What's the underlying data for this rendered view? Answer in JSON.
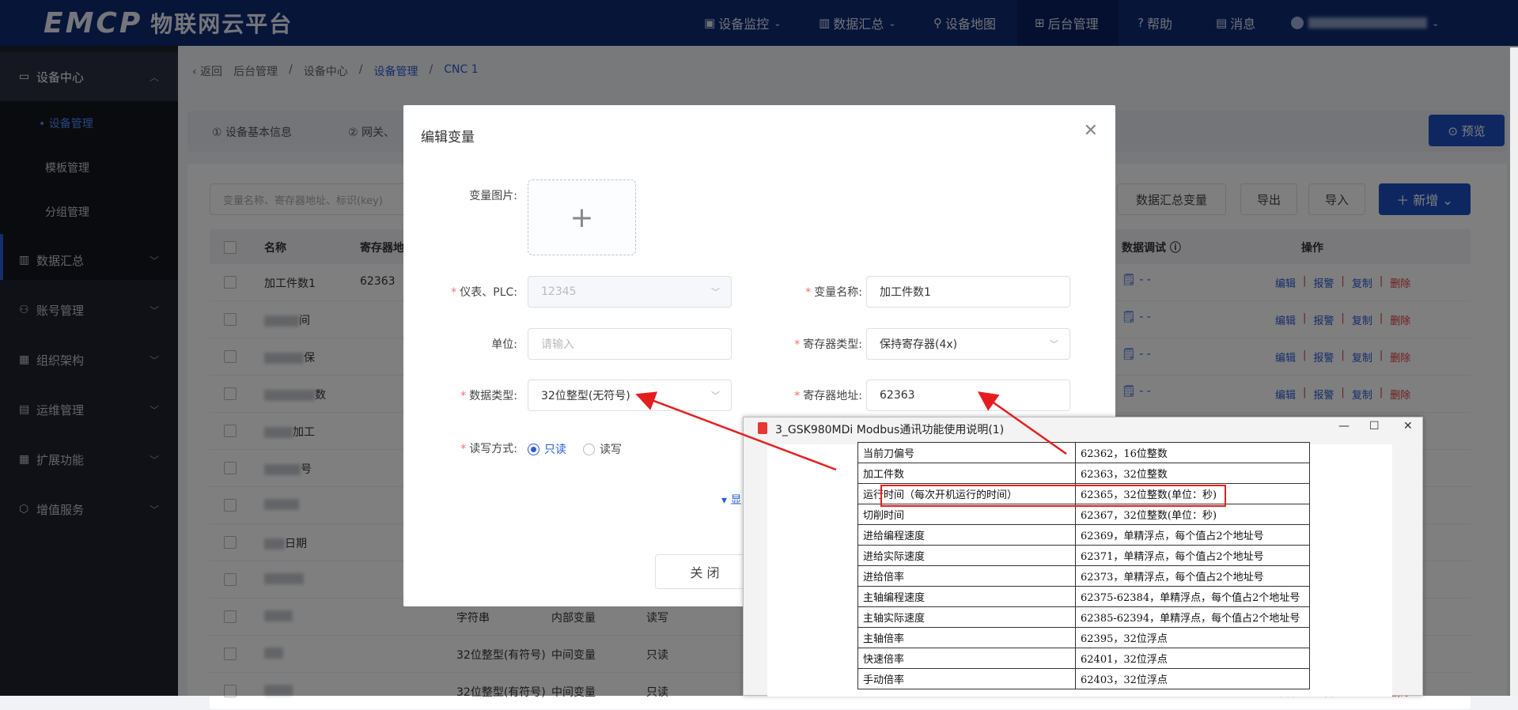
{
  "header": {
    "logo_en": "EMCP",
    "logo_cn": "物联网云平台",
    "nav": [
      {
        "icon": "▣",
        "label": "设备监控",
        "arrow": "⌄"
      },
      {
        "icon": "▥",
        "label": "数据汇总",
        "arrow": "⌄"
      },
      {
        "icon": "⚲",
        "label": "设备地图",
        "arrow": ""
      },
      {
        "icon": "⊞",
        "label": "后台管理",
        "arrow": ""
      },
      {
        "icon": "?",
        "label": "帮助",
        "arrow": ""
      },
      {
        "icon": "▤",
        "label": "消息",
        "arrow": ""
      }
    ],
    "user_arrow": "⌄"
  },
  "sidebar": {
    "groups": [
      {
        "icon": "▭",
        "label": "设备中心",
        "chevron": "︿"
      },
      {
        "icon": "▥",
        "label": "数据汇总",
        "chevron": "﹀"
      },
      {
        "icon": "⚇",
        "label": "账号管理",
        "chevron": "﹀"
      },
      {
        "icon": "▦",
        "label": "组织架构",
        "chevron": "﹀"
      },
      {
        "icon": "▤",
        "label": "运维管理",
        "chevron": "﹀"
      },
      {
        "icon": "▦",
        "label": "扩展功能",
        "chevron": "﹀"
      },
      {
        "icon": "⬡",
        "label": "增值服务",
        "chevron": "﹀"
      }
    ],
    "subitems": [
      "• 设备管理",
      "模板管理",
      "分组管理"
    ]
  },
  "breadcrumb": {
    "back": "‹ 返回",
    "items": [
      "后台管理",
      "/",
      "设备中心",
      "/",
      "设备管理",
      "/",
      "CNC 1"
    ]
  },
  "tabs": [
    "① 设备基本信息",
    "② 网关、"
  ],
  "preview_label": "⊙ 预览",
  "toolbar": {
    "search_placeholder": "变量名称、寄存器地址、标识(key)",
    "summary_btn": "数据汇总变量",
    "export_btn": "导出",
    "import_btn": "导入",
    "add_btn": "＋ 新增 ⌄"
  },
  "table": {
    "headers": [
      "名称",
      "寄存器地",
      "数据调试 ⓘ",
      "操作"
    ],
    "rows": [
      {
        "name": "加工件数1",
        "addr": "62363",
        "type": "",
        "kind": "",
        "rw": ""
      },
      {
        "name": "间",
        "addr": "",
        "type": "",
        "kind": "",
        "rw": ""
      },
      {
        "name": "保",
        "addr": "",
        "type": "",
        "kind": "",
        "rw": ""
      },
      {
        "name": "数",
        "addr": "",
        "type": "",
        "kind": "",
        "rw": ""
      },
      {
        "name": "加工",
        "addr": "",
        "type": "",
        "kind": "",
        "rw": ""
      },
      {
        "name": "号",
        "addr": "",
        "type": "",
        "kind": "",
        "rw": ""
      },
      {
        "name": "",
        "addr": "",
        "type": "",
        "kind": "",
        "rw": ""
      },
      {
        "name": "日期",
        "addr": "",
        "type": "",
        "kind": "",
        "rw": ""
      },
      {
        "name": "",
        "addr": "",
        "type": "",
        "kind": "",
        "rw": ""
      },
      {
        "name": "",
        "addr": "",
        "type": "字符串",
        "kind": "内部变量",
        "rw": "读写"
      },
      {
        "name": "",
        "addr": "",
        "type": "32位整型(有符号)",
        "kind": "中间变量",
        "rw": "只读"
      },
      {
        "name": "",
        "addr": "",
        "type": "32位整型(有符号)",
        "kind": "中间变量",
        "rw": "只读"
      }
    ],
    "debug_value": "- -",
    "ops": {
      "edit": "编辑",
      "alarm": "报警",
      "copy": "复制",
      "delete": "删除",
      "sep": "|"
    }
  },
  "modal": {
    "title": "编辑变量",
    "close": "✕",
    "image_label": "变量图片:",
    "upload_plus": "+",
    "plc_label": "仪表、PLC:",
    "plc_value": "12345",
    "varname_label": "变量名称:",
    "varname_value": "加工件数1",
    "unit_label": "单位:",
    "unit_placeholder": "请输入",
    "regtype_label": "寄存器类型:",
    "regtype_value": "保持寄存器(4x)",
    "datatype_label": "数据类型:",
    "datatype_value": "32位整型(无符号)",
    "regaddr_label": "寄存器地址:",
    "regaddr_value": "62363",
    "rw_label": "读写方式:",
    "rw_options": [
      "只读",
      "读写"
    ],
    "more_label": "▾ 显",
    "close_btn": "关 闭"
  },
  "pdf": {
    "title": "3_GSK980MDi Modbus通讯功能使用说明(1)",
    "controls": [
      "—",
      "☐",
      "✕"
    ],
    "rows": [
      [
        "当前刀偏号",
        "62362，16位整数"
      ],
      [
        "加工件数",
        "62363，32位整数"
      ],
      [
        "运行时间（每次开机运行的时间）",
        "62365，32位整数(单位：秒)"
      ],
      [
        "切削时间",
        "62367，32位整数(单位：秒)"
      ],
      [
        "进给编程速度",
        "62369，单精浮点，每个值占2个地址号"
      ],
      [
        "进给实际速度",
        "62371，单精浮点，每个值占2个地址号"
      ],
      [
        "进给倍率",
        "62373，单精浮点，每个值占2个地址号"
      ],
      [
        "主轴编程速度",
        "62375-62384，单精浮点，每个值占2个地址号"
      ],
      [
        "主轴实际速度",
        "62385-62394，单精浮点，每个值占2个地址号"
      ],
      [
        "主轴倍率",
        "62395，32位浮点"
      ],
      [
        "快速倍率",
        "62401，32位浮点"
      ],
      [
        "手动倍率",
        "62403，32位浮点"
      ]
    ]
  },
  "colors": {
    "header_bg": "#0f2a73",
    "sidebar_bg": "#1e222d",
    "accent": "#1e4fc2",
    "highlight": "#e41e1e"
  }
}
